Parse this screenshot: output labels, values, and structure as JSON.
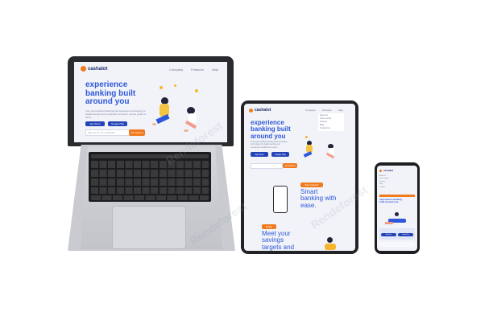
{
  "brand": {
    "name": "cashalot",
    "accent": "#f07a1d",
    "primary": "#2f57d9",
    "dark": "#1a2a6c"
  },
  "laptop": {
    "nav": [
      "Company",
      "Features",
      "Help"
    ],
    "hero_lines": [
      "experience",
      "banking built",
      "around you"
    ],
    "paragraph": "Your personalized banking that leverages technology for digital savings and investment solutions, simple goals for users.",
    "store_buttons": [
      "App Store",
      "Google Play"
    ],
    "input_placeholder": "Sign up for our newsletter",
    "cta": "Get Started"
  },
  "tablet": {
    "nav": [
      "Company",
      "Features",
      "Help"
    ],
    "menu_items": [
      "About Us",
      "How it works",
      "Careers",
      "Blog",
      "Contact Us"
    ],
    "hero_lines": [
      "experience",
      "banking built",
      "around you"
    ],
    "paragraph": "Your personalized banking that leverages technology for digital savings and investment solutions for users.",
    "store_buttons": [
      "App Store",
      "Google Play"
    ],
    "cta": "Get Started",
    "why_badge": "Why Cashalot?",
    "smart_lines": [
      "Smart",
      "banking with",
      "ease."
    ],
    "budget_badge": "Budget",
    "savings_lines": [
      "Meet your",
      "savings",
      "targets and"
    ]
  },
  "phone": {
    "menu_items": [
      "About Us",
      "How it works",
      "Careers",
      "Blog",
      "Contact"
    ],
    "heading": "experience banking built around you",
    "store_buttons": [
      "App Store",
      "Google Play"
    ]
  },
  "watermark": "Rendeforest"
}
